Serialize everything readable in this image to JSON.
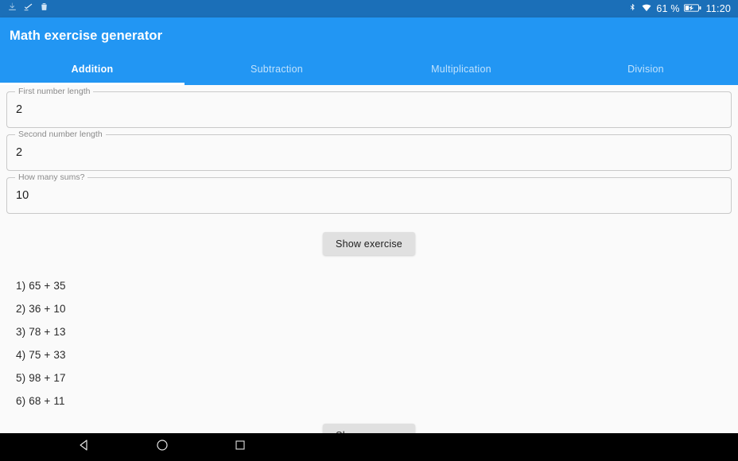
{
  "status_bar": {
    "notification_icons": [
      "download-icon",
      "check-edit-icon",
      "trash-icon"
    ],
    "bluetooth_icon": "bluetooth-icon",
    "wifi_icon": "wifi-icon",
    "battery_percent": "61 %",
    "battery_icon": "battery-charging-icon",
    "clock": "11:20",
    "background_color": "#1b6fb8"
  },
  "app_bar": {
    "title": "Math exercise generator",
    "background_color": "#2296f3",
    "tabs": [
      {
        "label": "Addition",
        "active": true
      },
      {
        "label": "Subtraction",
        "active": false
      },
      {
        "label": "Multiplication",
        "active": false
      },
      {
        "label": "Division",
        "active": false
      }
    ]
  },
  "form": {
    "fields": [
      {
        "label": "First number length",
        "value": "2"
      },
      {
        "label": "Second number length",
        "value": "2"
      },
      {
        "label": "How many sums?",
        "value": "10"
      }
    ],
    "show_exercise_button": "Show exercise",
    "show_answers_button": "Show answers"
  },
  "exercises": [
    "1) 65 + 35",
    "2) 36 + 10",
    "3) 78 + 13",
    "4) 75 + 33",
    "5) 98 + 17",
    "6) 68 + 11"
  ],
  "nav_bar": {
    "back": "back-icon",
    "home": "home-icon",
    "recents": "recents-icon",
    "background_color": "#000000"
  }
}
